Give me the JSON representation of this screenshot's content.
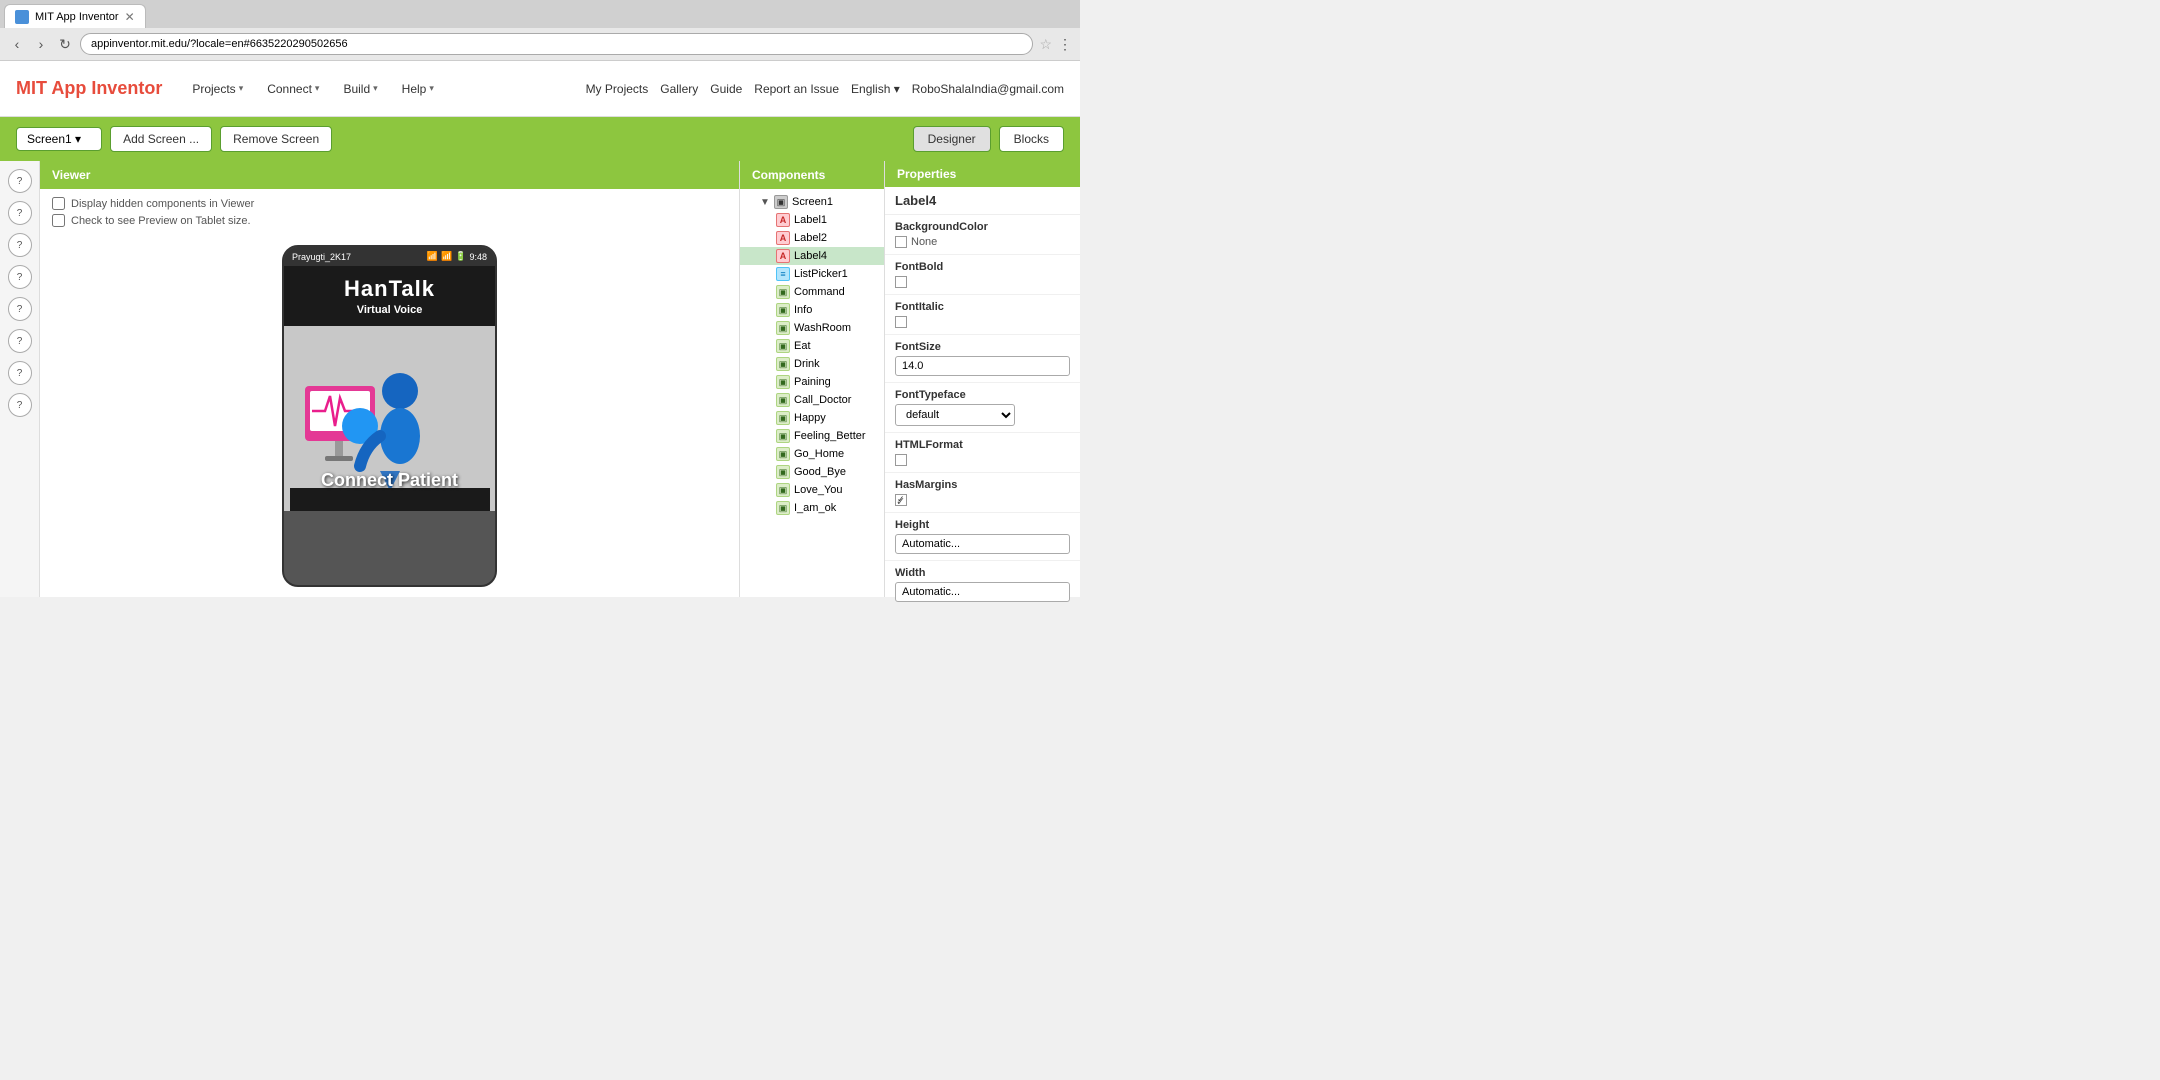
{
  "browser": {
    "tab_label": "MIT App Inventor",
    "url": "appinventor.mit.edu/?locale=en#6635220290502656",
    "close_icon": "✕"
  },
  "header": {
    "logo": "MIT App Inventor",
    "nav": [
      {
        "label": "Projects",
        "has_arrow": true
      },
      {
        "label": "Connect",
        "has_arrow": true
      },
      {
        "label": "Build",
        "has_arrow": true
      },
      {
        "label": "Help",
        "has_arrow": true
      }
    ],
    "right_links": [
      "My Projects",
      "Gallery",
      "Guide",
      "Report an Issue"
    ],
    "language": "English",
    "user": "RoboShalaIndia@gmail.com"
  },
  "toolbar": {
    "screen_name": "Screen1",
    "add_screen_label": "Add Screen ...",
    "remove_screen_label": "Remove Screen",
    "designer_label": "Designer",
    "blocks_label": "Blocks"
  },
  "viewer": {
    "panel_title": "Viewer",
    "checkbox1": "Display hidden components in Viewer",
    "checkbox2": "Check to see Preview on Tablet size.",
    "phone": {
      "status_bar_left": "Prayugti_2K17",
      "status_bar_time": "9:48",
      "app_title": "HanTalk",
      "app_subtitle": "Virtual Voice",
      "connect_text": "Connect Patient"
    }
  },
  "components": {
    "panel_title": "Components",
    "tree": [
      {
        "label": "Screen1",
        "icon": "screen",
        "indent": 0,
        "toggle": "▼"
      },
      {
        "label": "Label1",
        "icon": "label",
        "indent": 1
      },
      {
        "label": "Label2",
        "icon": "label",
        "indent": 1
      },
      {
        "label": "Label4",
        "icon": "label",
        "indent": 1,
        "selected": true
      },
      {
        "label": "ListPicker1",
        "icon": "listpicker",
        "indent": 1
      },
      {
        "label": "Command",
        "icon": "button",
        "indent": 1
      },
      {
        "label": "Info",
        "icon": "button",
        "indent": 1
      },
      {
        "label": "WashRoom",
        "icon": "button",
        "indent": 1
      },
      {
        "label": "Eat",
        "icon": "button",
        "indent": 1
      },
      {
        "label": "Drink",
        "icon": "button",
        "indent": 1
      },
      {
        "label": "Paining",
        "icon": "button",
        "indent": 1
      },
      {
        "label": "Call_Doctor",
        "icon": "button",
        "indent": 1
      },
      {
        "label": "Happy",
        "icon": "button",
        "indent": 1
      },
      {
        "label": "Feeling_Better",
        "icon": "button",
        "indent": 1
      },
      {
        "label": "Go_Home",
        "icon": "button",
        "indent": 1
      },
      {
        "label": "Good_Bye",
        "icon": "button",
        "indent": 1
      },
      {
        "label": "Love_You",
        "icon": "button",
        "indent": 1
      },
      {
        "label": "I_am_ok",
        "icon": "button",
        "indent": 1
      }
    ]
  },
  "properties": {
    "panel_title": "Properties",
    "component_name": "Label4",
    "sections": [
      {
        "label": "BackgroundColor",
        "type": "color_none",
        "value": "None"
      },
      {
        "label": "FontBold",
        "type": "checkbox",
        "checked": false
      },
      {
        "label": "FontItalic",
        "type": "checkbox",
        "checked": false
      },
      {
        "label": "FontSize",
        "type": "input",
        "value": "14.0"
      },
      {
        "label": "FontTypeface",
        "type": "select",
        "value": "default"
      },
      {
        "label": "HTMLFormat",
        "type": "checkbox",
        "checked": false
      },
      {
        "label": "HasMargins",
        "type": "checkbox",
        "checked": true
      },
      {
        "label": "Height",
        "type": "input",
        "value": "Automatic..."
      },
      {
        "label": "Width",
        "type": "input",
        "value": "Automatic..."
      }
    ]
  }
}
